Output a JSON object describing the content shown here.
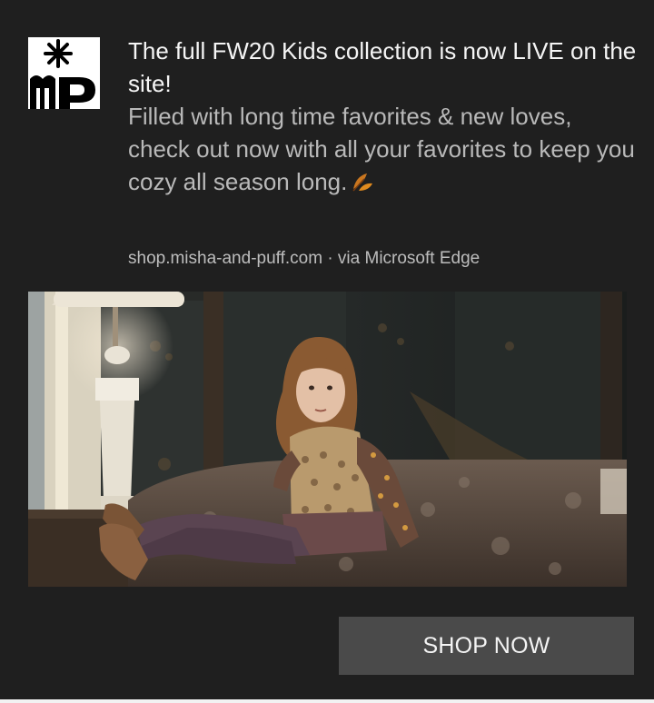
{
  "notification": {
    "title": "The full FW20 Kids collection is now LIVE on the site!",
    "body": "Filled with long time favorites & new loves, check out now with all your favorites to keep you cozy all season long.",
    "body_icon": "leaf-emoji",
    "source": "shop.misha-and-puff.com · via Microsoft Edge",
    "logo_icon": "misha-and-puff-logo",
    "image_alt": "Child in knit vest sitting on a bed",
    "button_label": "SHOP NOW"
  },
  "colors": {
    "background": "#1f1f1f",
    "title": "#f5f5f5",
    "body": "#b9b9b9",
    "button": "#4a4a4a"
  }
}
